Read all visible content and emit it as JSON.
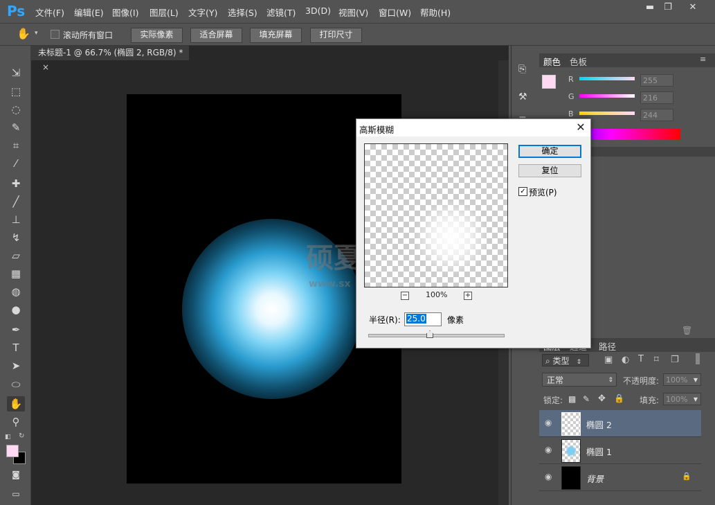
{
  "app": {
    "logo": "Ps"
  },
  "menu": [
    "文件(F)",
    "编辑(E)",
    "图像(I)",
    "图层(L)",
    "文字(Y)",
    "选择(S)",
    "滤镜(T)",
    "3D(D)",
    "视图(V)",
    "窗口(W)",
    "帮助(H)"
  ],
  "window_controls": {
    "minimize": "▬",
    "restore": "❐",
    "close": "✕"
  },
  "options_bar": {
    "scroll_all_label": "滚动所有窗口",
    "buttons": [
      "实际像素",
      "适合屏幕",
      "填充屏幕",
      "打印尺寸"
    ]
  },
  "document": {
    "tab_title": "未标题-1 @ 66.7% (椭圆 2, RGB/8) *",
    "tab_close": "×"
  },
  "watermark": {
    "text": "硕夏",
    "url": "www.sx"
  },
  "color_panel": {
    "tabs": [
      "颜色",
      "色板"
    ],
    "channels": [
      {
        "label": "R",
        "value": "255"
      },
      {
        "label": "G",
        "value": "216"
      },
      {
        "label": "B",
        "value": "244"
      }
    ],
    "foreground": "#ffd8f4",
    "background": "#000000"
  },
  "layers_panel": {
    "tabs": [
      "图层",
      "通道",
      "路径"
    ],
    "filter_kind": "类型",
    "blend_mode": "正常",
    "opacity_label": "不透明度:",
    "opacity_value": "100%",
    "lock_label": "锁定:",
    "fill_label": "填充:",
    "fill_value": "100%",
    "layers": [
      {
        "name": "椭圆 2",
        "selected": true
      },
      {
        "name": "椭圆 1",
        "selected": false
      },
      {
        "name": "背景",
        "selected": false,
        "locked": true
      }
    ]
  },
  "dialog": {
    "title": "高斯模糊",
    "ok": "确定",
    "reset": "复位",
    "preview_label": "预览(P)",
    "preview_checked": true,
    "zoom": "100%",
    "radius_label": "半径(R):",
    "radius_value": "25.0",
    "radius_unit": "像素"
  }
}
